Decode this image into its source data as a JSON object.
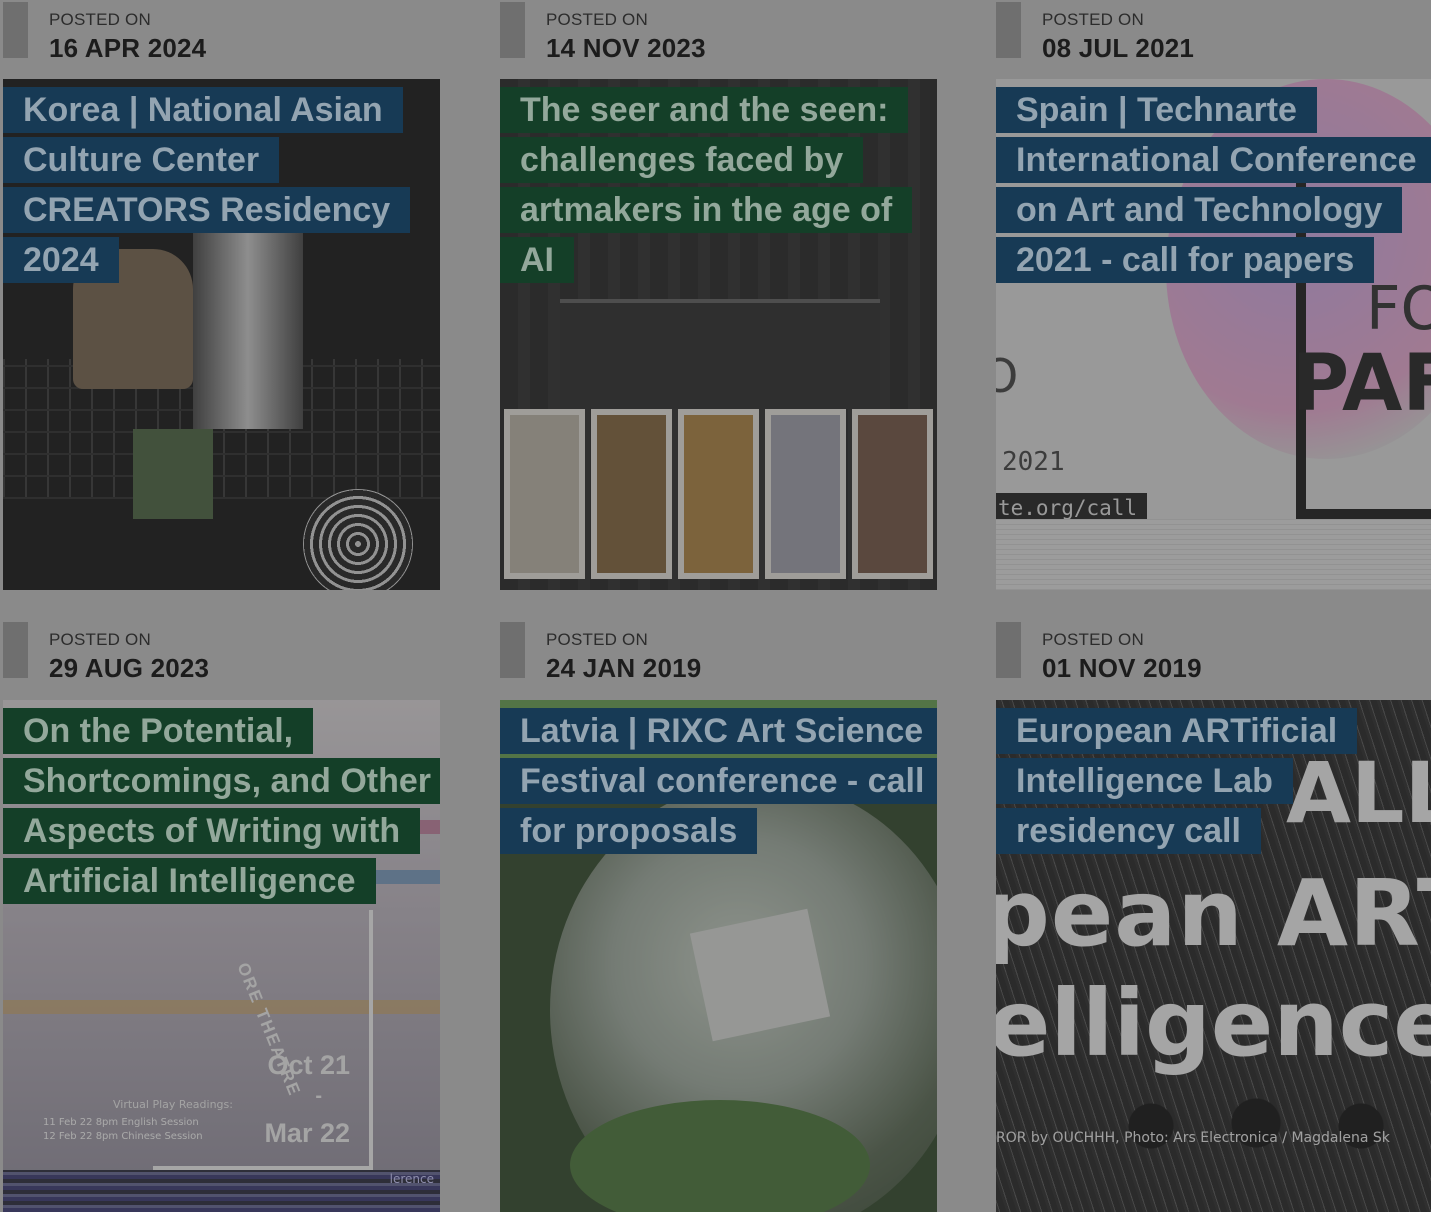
{
  "posted_label": "POSTED ON",
  "posts": [
    {
      "date": "16 APR 2024",
      "title": "Korea | National Asian Culture Center CREATORS Residency 2024",
      "tag_color": "#173a55"
    },
    {
      "date": "14 NOV 2023",
      "title": "The seer and the seen: challenges faced by artmakers in the age of AI",
      "tag_color": "#143f28"
    },
    {
      "date": "08 JUL 2021",
      "title": "Spain | Technarte International Conference on Art and Technology 2021 - call for papers",
      "tag_color": "#173a55",
      "image_text": {
        "big": "PAF",
        "fo": "FO",
        "year": "2021",
        "url": "te.org/call",
        "o": "O"
      }
    },
    {
      "date": "29 AUG 2023",
      "title": "On the Potential, Shortcomings, and Other Aspects of Writing with Artificial Intelligence",
      "tag_color": "#143f28",
      "image_text": {
        "vertical": "ORE THEATRE",
        "date1": "Oct 21",
        "dash": "-",
        "date2": "Mar 22",
        "readings": "Virtual Play Readings:",
        "session1": "11 Feb 22 8pm English Session",
        "session2": "12 Feb 22 8pm Chinese Session",
        "lobe": "lerence"
      }
    },
    {
      "date": "24 JAN 2019",
      "title": "Latvia | RIXC Art Science Festival conference - call for proposals",
      "tag_color": "#173a55"
    },
    {
      "date": "01 NOV 2019",
      "title": "European ARTificial Intelligence Lab residency call",
      "tag_color": "#173a55",
      "image_text": {
        "all": "ALL",
        "line1": "pean ARTif",
        "line2": "elligence L",
        "caption": "ROR by OUCHHH, Photo: Ars Electronica / Magdalena Sk"
      }
    }
  ]
}
